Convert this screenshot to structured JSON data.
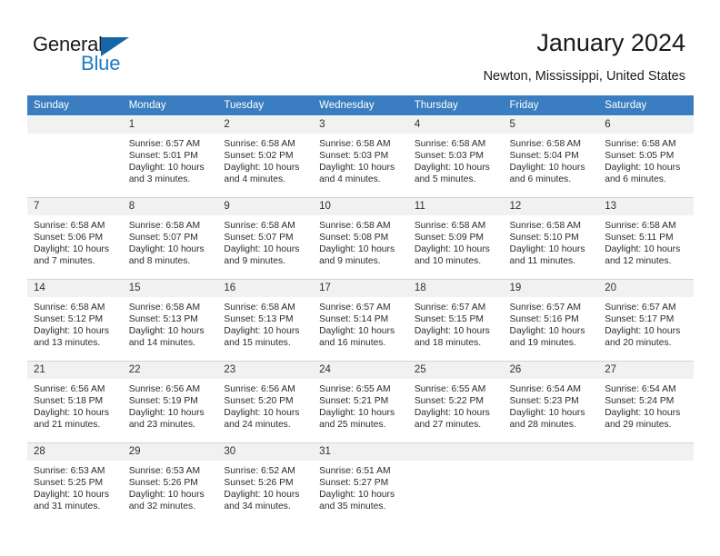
{
  "logo": {
    "word_dark": "General",
    "word_blue": "Blue",
    "triangle_color": "#1466a8",
    "blue_color": "#1f7bc1"
  },
  "header": {
    "title": "January 2024",
    "location": "Newton, Mississippi, United States",
    "header_bg": "#3a7dc0",
    "daynum_bg": "#f1f1f1"
  },
  "calendar": {
    "weekday_headers": [
      "Sunday",
      "Monday",
      "Tuesday",
      "Wednesday",
      "Thursday",
      "Friday",
      "Saturday"
    ],
    "weeks": [
      [
        {
          "day": "",
          "empty": true
        },
        {
          "day": "1",
          "sunrise": "Sunrise: 6:57 AM",
          "sunset": "Sunset: 5:01 PM",
          "daylight1": "Daylight: 10 hours",
          "daylight2": "and 3 minutes."
        },
        {
          "day": "2",
          "sunrise": "Sunrise: 6:58 AM",
          "sunset": "Sunset: 5:02 PM",
          "daylight1": "Daylight: 10 hours",
          "daylight2": "and 4 minutes."
        },
        {
          "day": "3",
          "sunrise": "Sunrise: 6:58 AM",
          "sunset": "Sunset: 5:03 PM",
          "daylight1": "Daylight: 10 hours",
          "daylight2": "and 4 minutes."
        },
        {
          "day": "4",
          "sunrise": "Sunrise: 6:58 AM",
          "sunset": "Sunset: 5:03 PM",
          "daylight1": "Daylight: 10 hours",
          "daylight2": "and 5 minutes."
        },
        {
          "day": "5",
          "sunrise": "Sunrise: 6:58 AM",
          "sunset": "Sunset: 5:04 PM",
          "daylight1": "Daylight: 10 hours",
          "daylight2": "and 6 minutes."
        },
        {
          "day": "6",
          "sunrise": "Sunrise: 6:58 AM",
          "sunset": "Sunset: 5:05 PM",
          "daylight1": "Daylight: 10 hours",
          "daylight2": "and 6 minutes."
        }
      ],
      [
        {
          "day": "7",
          "sunrise": "Sunrise: 6:58 AM",
          "sunset": "Sunset: 5:06 PM",
          "daylight1": "Daylight: 10 hours",
          "daylight2": "and 7 minutes."
        },
        {
          "day": "8",
          "sunrise": "Sunrise: 6:58 AM",
          "sunset": "Sunset: 5:07 PM",
          "daylight1": "Daylight: 10 hours",
          "daylight2": "and 8 minutes."
        },
        {
          "day": "9",
          "sunrise": "Sunrise: 6:58 AM",
          "sunset": "Sunset: 5:07 PM",
          "daylight1": "Daylight: 10 hours",
          "daylight2": "and 9 minutes."
        },
        {
          "day": "10",
          "sunrise": "Sunrise: 6:58 AM",
          "sunset": "Sunset: 5:08 PM",
          "daylight1": "Daylight: 10 hours",
          "daylight2": "and 9 minutes."
        },
        {
          "day": "11",
          "sunrise": "Sunrise: 6:58 AM",
          "sunset": "Sunset: 5:09 PM",
          "daylight1": "Daylight: 10 hours",
          "daylight2": "and 10 minutes."
        },
        {
          "day": "12",
          "sunrise": "Sunrise: 6:58 AM",
          "sunset": "Sunset: 5:10 PM",
          "daylight1": "Daylight: 10 hours",
          "daylight2": "and 11 minutes."
        },
        {
          "day": "13",
          "sunrise": "Sunrise: 6:58 AM",
          "sunset": "Sunset: 5:11 PM",
          "daylight1": "Daylight: 10 hours",
          "daylight2": "and 12 minutes."
        }
      ],
      [
        {
          "day": "14",
          "sunrise": "Sunrise: 6:58 AM",
          "sunset": "Sunset: 5:12 PM",
          "daylight1": "Daylight: 10 hours",
          "daylight2": "and 13 minutes."
        },
        {
          "day": "15",
          "sunrise": "Sunrise: 6:58 AM",
          "sunset": "Sunset: 5:13 PM",
          "daylight1": "Daylight: 10 hours",
          "daylight2": "and 14 minutes."
        },
        {
          "day": "16",
          "sunrise": "Sunrise: 6:58 AM",
          "sunset": "Sunset: 5:13 PM",
          "daylight1": "Daylight: 10 hours",
          "daylight2": "and 15 minutes."
        },
        {
          "day": "17",
          "sunrise": "Sunrise: 6:57 AM",
          "sunset": "Sunset: 5:14 PM",
          "daylight1": "Daylight: 10 hours",
          "daylight2": "and 16 minutes."
        },
        {
          "day": "18",
          "sunrise": "Sunrise: 6:57 AM",
          "sunset": "Sunset: 5:15 PM",
          "daylight1": "Daylight: 10 hours",
          "daylight2": "and 18 minutes."
        },
        {
          "day": "19",
          "sunrise": "Sunrise: 6:57 AM",
          "sunset": "Sunset: 5:16 PM",
          "daylight1": "Daylight: 10 hours",
          "daylight2": "and 19 minutes."
        },
        {
          "day": "20",
          "sunrise": "Sunrise: 6:57 AM",
          "sunset": "Sunset: 5:17 PM",
          "daylight1": "Daylight: 10 hours",
          "daylight2": "and 20 minutes."
        }
      ],
      [
        {
          "day": "21",
          "sunrise": "Sunrise: 6:56 AM",
          "sunset": "Sunset: 5:18 PM",
          "daylight1": "Daylight: 10 hours",
          "daylight2": "and 21 minutes."
        },
        {
          "day": "22",
          "sunrise": "Sunrise: 6:56 AM",
          "sunset": "Sunset: 5:19 PM",
          "daylight1": "Daylight: 10 hours",
          "daylight2": "and 23 minutes."
        },
        {
          "day": "23",
          "sunrise": "Sunrise: 6:56 AM",
          "sunset": "Sunset: 5:20 PM",
          "daylight1": "Daylight: 10 hours",
          "daylight2": "and 24 minutes."
        },
        {
          "day": "24",
          "sunrise": "Sunrise: 6:55 AM",
          "sunset": "Sunset: 5:21 PM",
          "daylight1": "Daylight: 10 hours",
          "daylight2": "and 25 minutes."
        },
        {
          "day": "25",
          "sunrise": "Sunrise: 6:55 AM",
          "sunset": "Sunset: 5:22 PM",
          "daylight1": "Daylight: 10 hours",
          "daylight2": "and 27 minutes."
        },
        {
          "day": "26",
          "sunrise": "Sunrise: 6:54 AM",
          "sunset": "Sunset: 5:23 PM",
          "daylight1": "Daylight: 10 hours",
          "daylight2": "and 28 minutes."
        },
        {
          "day": "27",
          "sunrise": "Sunrise: 6:54 AM",
          "sunset": "Sunset: 5:24 PM",
          "daylight1": "Daylight: 10 hours",
          "daylight2": "and 29 minutes."
        }
      ],
      [
        {
          "day": "28",
          "sunrise": "Sunrise: 6:53 AM",
          "sunset": "Sunset: 5:25 PM",
          "daylight1": "Daylight: 10 hours",
          "daylight2": "and 31 minutes."
        },
        {
          "day": "29",
          "sunrise": "Sunrise: 6:53 AM",
          "sunset": "Sunset: 5:26 PM",
          "daylight1": "Daylight: 10 hours",
          "daylight2": "and 32 minutes."
        },
        {
          "day": "30",
          "sunrise": "Sunrise: 6:52 AM",
          "sunset": "Sunset: 5:26 PM",
          "daylight1": "Daylight: 10 hours",
          "daylight2": "and 34 minutes."
        },
        {
          "day": "31",
          "sunrise": "Sunrise: 6:51 AM",
          "sunset": "Sunset: 5:27 PM",
          "daylight1": "Daylight: 10 hours",
          "daylight2": "and 35 minutes."
        },
        {
          "day": "",
          "empty": true
        },
        {
          "day": "",
          "empty": true
        },
        {
          "day": "",
          "empty": true
        }
      ]
    ]
  }
}
